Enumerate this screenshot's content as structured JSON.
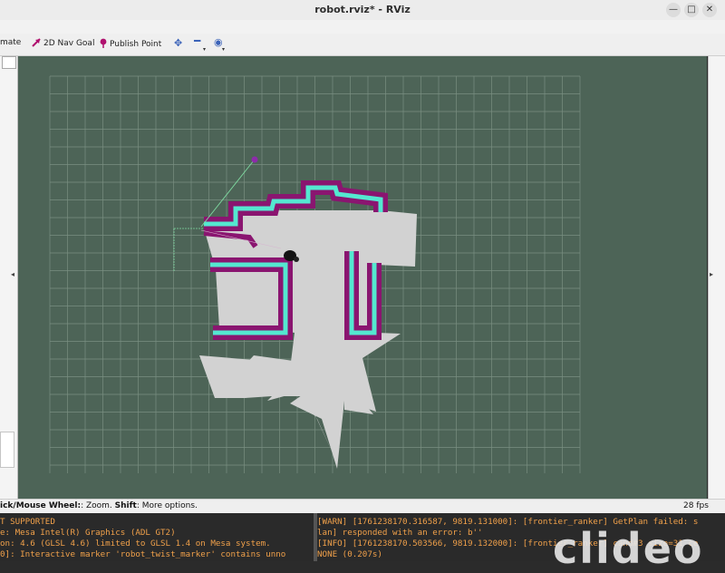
{
  "window": {
    "title": "robot.rviz* - RViz",
    "controls": [
      "—",
      "□",
      "✕"
    ]
  },
  "toolbar": {
    "partial_tool_label": "mate",
    "nav_goal_label": "2D Nav Goal",
    "publish_point_label": "Publish Point",
    "move_camera_icon": "plus-move-icon",
    "zoom_out_icon": "minus-icon",
    "view_icon": "eye-icon"
  },
  "status": {
    "hint_bold": "ick/Mouse Wheel:",
    "hint_rest": ": Zoom. ",
    "hint_shift": "Shift",
    "hint_tail": ": More options.",
    "fps": "28 fps"
  },
  "terminal_left": [
    "T SUPPORTED",
    "e: Mesa Intel(R) Graphics (ADL GT2)",
    "on: 4.6 (GLSL 4.6) limited to GLSL 1.4 on Mesa system.",
    "0]: Interactive marker 'robot_twist_marker' contains unno"
  ],
  "terminal_right": [
    "[WARN] [1761238170.316587, 9819.131000]: [frontier_ranker] GetPlan failed: s",
    "lan] responded with an error: b''",
    "[INFO] [1761238170.503566, 9819.132000]: [frontier_ranker] cand#3 size=31 ce",
    " NONE (0.207s)"
  ],
  "watermark": "clideo",
  "colors": {
    "grid_bg": "#4d6457",
    "grid_line": "#7a8f82",
    "free_space": "#d2d2d2",
    "costmap_outer": "#8a1570",
    "costmap_inner": "#54e8d0",
    "terminal_text": "#f0a04a"
  }
}
